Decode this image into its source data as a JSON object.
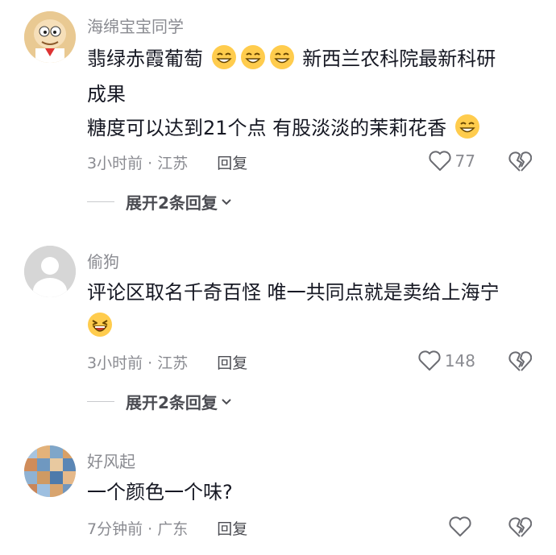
{
  "comments": [
    {
      "username": "海绵宝宝同学",
      "line1_a": "翡绿赤霞葡萄",
      "line1_b": "新西兰农科院最新科研",
      "line2": "成果",
      "line3": "糖度可以达到21个点 有股淡淡的茉莉花香",
      "time_location": "3小时前 · 江苏",
      "reply_label": "回复",
      "likes": "77",
      "expand_label": "展开2条回复"
    },
    {
      "username": "偷狗",
      "line1": "评论区取名千奇百怪 唯一共同点就是卖给上海宁",
      "time_location": "3小时前 · 江苏",
      "reply_label": "回复",
      "likes": "148",
      "expand_label": "展开2条回复"
    },
    {
      "username": "好风起",
      "line1": "一个颜色一个味?",
      "time_location": "7分钟前 · 广东",
      "reply_label": "回复",
      "likes": ""
    }
  ],
  "icons": {
    "like": "heart-outline-icon",
    "dislike": "broken-heart-icon",
    "expand": "chevron-down-icon",
    "emoji_smile": "smiling-emoji-icon",
    "emoji_laugh": "laughing-emoji-icon"
  },
  "colors": {
    "text": "#161823",
    "secondary": "#8a8b91",
    "emoji_face": "#ffcc4d"
  }
}
